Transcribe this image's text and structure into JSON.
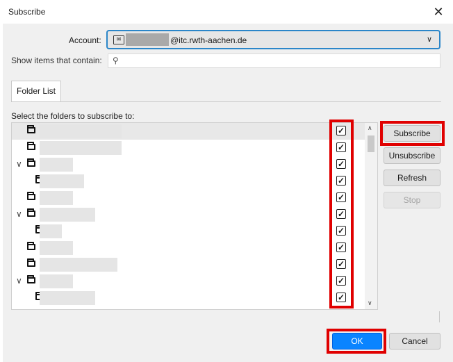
{
  "window": {
    "title": "Subscribe"
  },
  "account": {
    "label": "Account:",
    "email_suffix": "@itc.rwth-aachen.de"
  },
  "search": {
    "label": "Show items that contain:",
    "placeholder": ""
  },
  "tabs": [
    {
      "label": "Folder List"
    }
  ],
  "list": {
    "header": "Select the folders to subscribe to:",
    "rows": [
      {
        "twisty": "",
        "checked": true,
        "selected": true
      },
      {
        "twisty": "",
        "checked": true
      },
      {
        "twisty": "∨",
        "checked": true
      },
      {
        "twisty": "",
        "checked": true
      },
      {
        "twisty": "",
        "checked": true
      },
      {
        "twisty": "∨",
        "checked": true
      },
      {
        "twisty": "",
        "checked": true
      },
      {
        "twisty": "",
        "checked": true
      },
      {
        "twisty": "",
        "checked": true
      },
      {
        "twisty": "∨",
        "checked": true
      },
      {
        "twisty": "",
        "checked": true
      }
    ]
  },
  "buttons": {
    "subscribe": "Subscribe",
    "unsubscribe": "Unsubscribe",
    "refresh": "Refresh",
    "stop": "Stop",
    "ok": "OK",
    "cancel": "Cancel"
  },
  "colors": {
    "accent": "#0a84ff",
    "highlight": "#e00000",
    "focus": "#2b86c9"
  }
}
